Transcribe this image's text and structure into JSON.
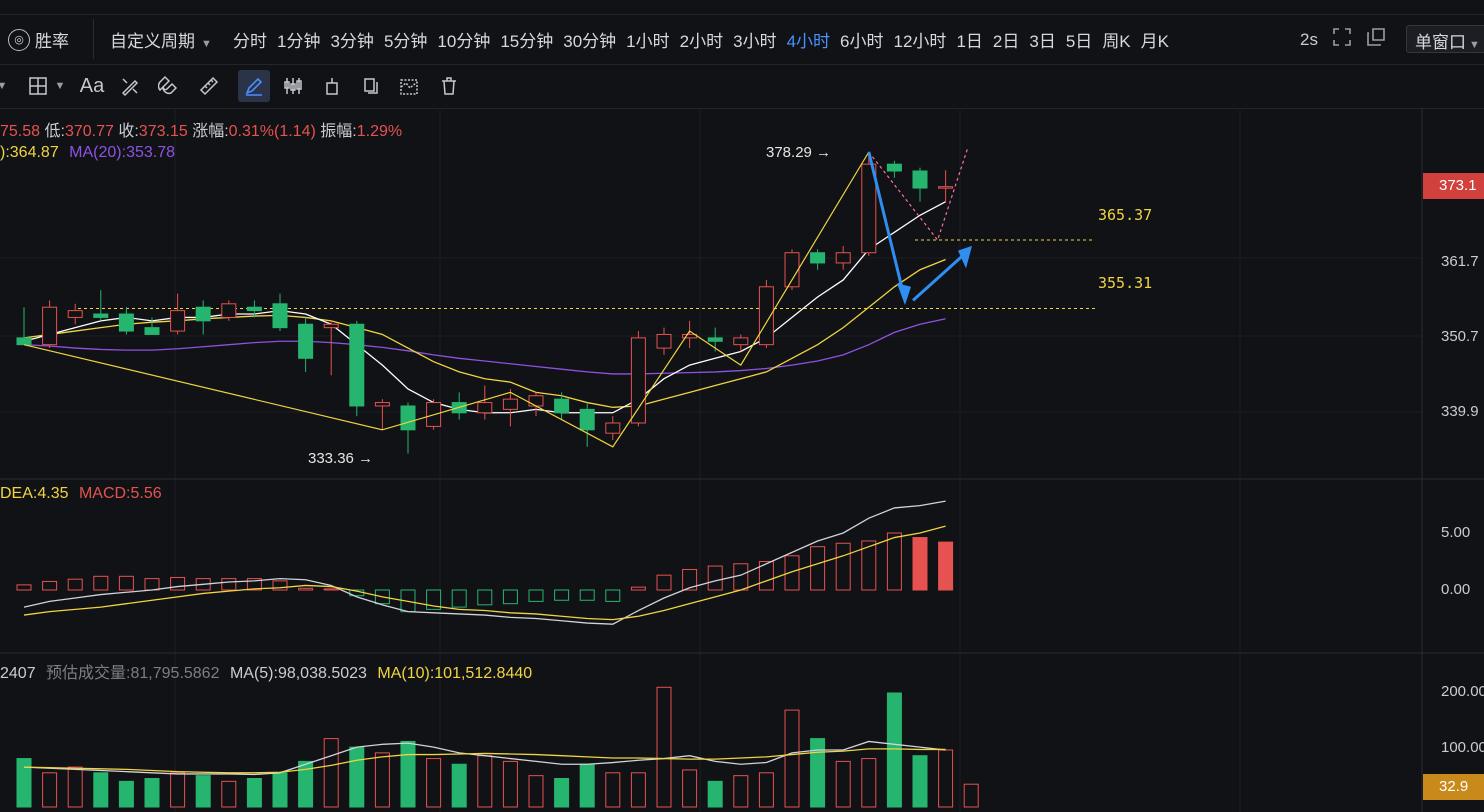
{
  "topbar": {
    "winrate_label": "胜率",
    "custom_period_label": "自定义周期",
    "periods": [
      "分时",
      "1分钟",
      "3分钟",
      "5分钟",
      "10分钟",
      "15分钟",
      "30分钟",
      "1小时",
      "2小时",
      "3小时",
      "4小时",
      "6小时",
      "12小时",
      "1日",
      "2日",
      "3日",
      "5日",
      "周K",
      "月K"
    ],
    "active_period": "4小时",
    "refresh_label": "2s",
    "window_select": "单窗口"
  },
  "toolbar": {
    "text_tool_label": "Aa",
    "icons": [
      "chevron-down-icon",
      "crosshair-grid-icon",
      "text-icon",
      "brush-eraser-icon",
      "magnet-icon",
      "ruler-icon",
      "pen-icon",
      "candles-icon",
      "anchor-icon",
      "copy-icon",
      "measure-icon",
      "trash-icon"
    ]
  },
  "info": {
    "high_partial": "75.58",
    "low_label": "低:",
    "low_value": "370.77",
    "close_label": "收:",
    "close_value": "373.15",
    "change_label": "涨幅:",
    "change_value": "0.31%(1.14)",
    "amp_label": "振幅:",
    "amp_value": "1.29%",
    "ma_partial": "):364.87",
    "ma20_label": "MA(20):353.78",
    "macd_dea": "DEA:4.35",
    "macd_val": "MACD:5.56",
    "vol_partial": "2407",
    "vol_est_label": "预估成交量:",
    "vol_est_value": "81,795.5862",
    "vol_ma5": "MA(5):98,038.5023",
    "vol_ma10": "MA(10):101,512.8440"
  },
  "chart_data": {
    "type": "candlestick",
    "price_axis": [
      "361.7",
      "350.7",
      "339.9"
    ],
    "current_price": "373.1",
    "high_marker": "378.29",
    "low_marker": "333.36",
    "levels": [
      {
        "value": "365.37",
        "price": 365.37
      },
      {
        "value": "355.31",
        "price": 355.31
      }
    ],
    "price_range": [
      330,
      382
    ],
    "candles": [
      {
        "o": 351.0,
        "h": 355.5,
        "l": 350.0,
        "c": 350.0
      },
      {
        "o": 350.0,
        "h": 356.5,
        "l": 349.5,
        "c": 355.5
      },
      {
        "o": 354.0,
        "h": 356.0,
        "l": 353.0,
        "c": 355.0
      },
      {
        "o": 354.5,
        "h": 358.0,
        "l": 353.5,
        "c": 354.0
      },
      {
        "o": 354.5,
        "h": 355.5,
        "l": 351.5,
        "c": 352.0
      },
      {
        "o": 352.5,
        "h": 354.0,
        "l": 351.5,
        "c": 351.5
      },
      {
        "o": 352.0,
        "h": 357.5,
        "l": 351.5,
        "c": 355.0
      },
      {
        "o": 355.5,
        "h": 356.5,
        "l": 351.5,
        "c": 353.5
      },
      {
        "o": 354.0,
        "h": 356.5,
        "l": 353.5,
        "c": 356.0
      },
      {
        "o": 355.5,
        "h": 356.5,
        "l": 354.0,
        "c": 355.0
      },
      {
        "o": 356.0,
        "h": 357.5,
        "l": 352.0,
        "c": 352.5
      },
      {
        "o": 353.0,
        "h": 354.0,
        "l": 346.0,
        "c": 348.0
      },
      {
        "o": 352.5,
        "h": 353.5,
        "l": 345.5,
        "c": 353.0
      },
      {
        "o": 353.0,
        "h": 353.5,
        "l": 339.5,
        "c": 341.0
      },
      {
        "o": 341.0,
        "h": 342.0,
        "l": 337.5,
        "c": 341.5
      },
      {
        "o": 341.0,
        "h": 341.5,
        "l": 334.0,
        "c": 337.5
      },
      {
        "o": 338.0,
        "h": 342.0,
        "l": 337.5,
        "c": 341.5
      },
      {
        "o": 341.5,
        "h": 343.0,
        "l": 339.0,
        "c": 340.0
      },
      {
        "o": 340.0,
        "h": 344.0,
        "l": 339.0,
        "c": 341.5
      },
      {
        "o": 340.5,
        "h": 343.5,
        "l": 338.0,
        "c": 342.0
      },
      {
        "o": 341.0,
        "h": 343.0,
        "l": 339.5,
        "c": 342.5
      },
      {
        "o": 342.0,
        "h": 343.0,
        "l": 339.0,
        "c": 340.0
      },
      {
        "o": 340.5,
        "h": 341.5,
        "l": 335.0,
        "c": 337.5
      },
      {
        "o": 337.0,
        "h": 339.5,
        "l": 336.0,
        "c": 338.5
      },
      {
        "o": 338.5,
        "h": 352.0,
        "l": 338.0,
        "c": 351.0
      },
      {
        "o": 349.5,
        "h": 352.5,
        "l": 348.5,
        "c": 351.5
      },
      {
        "o": 351.0,
        "h": 353.5,
        "l": 349.5,
        "c": 351.5
      },
      {
        "o": 351.0,
        "h": 352.5,
        "l": 349.0,
        "c": 350.5
      },
      {
        "o": 350.0,
        "h": 351.5,
        "l": 349.0,
        "c": 351.0
      },
      {
        "o": 350.0,
        "h": 359.5,
        "l": 349.5,
        "c": 358.5
      },
      {
        "o": 358.5,
        "h": 364.0,
        "l": 358.0,
        "c": 363.5
      },
      {
        "o": 363.5,
        "h": 364.0,
        "l": 361.0,
        "c": 362.0
      },
      {
        "o": 362.0,
        "h": 364.5,
        "l": 361.0,
        "c": 363.5
      },
      {
        "o": 363.5,
        "h": 378.3,
        "l": 363.0,
        "c": 376.5
      },
      {
        "o": 376.5,
        "h": 377.0,
        "l": 374.5,
        "c": 375.5
      },
      {
        "o": 375.5,
        "h": 376.0,
        "l": 371.0,
        "c": 373.0
      },
      {
        "o": 373.0,
        "h": 375.6,
        "l": 370.8,
        "c": 373.2
      }
    ],
    "ma5": [
      350.5,
      351.5,
      352.5,
      353.5,
      354,
      353.5,
      354,
      354,
      354.5,
      354.5,
      355,
      354.5,
      353,
      350,
      347,
      343.5,
      341.5,
      340.5,
      340,
      340,
      340.5,
      340,
      340,
      340,
      342,
      345,
      347,
      348,
      349,
      351,
      354,
      357,
      359.5,
      364,
      366.5,
      369,
      371
    ],
    "ma10": [
      351,
      351.5,
      352,
      352.5,
      353,
      353.3,
      353.5,
      353.8,
      354,
      354.2,
      354.3,
      354,
      353.5,
      352.5,
      351.5,
      349.5,
      347.5,
      346,
      345,
      344.5,
      343,
      342.5,
      341.5,
      340.8,
      341,
      342,
      343,
      344,
      345,
      346,
      348,
      350,
      352.5,
      355.5,
      358.5,
      361,
      362.5
    ],
    "ma20": [
      350,
      349.8,
      349.5,
      349.3,
      349.2,
      349.2,
      349.4,
      349.7,
      350,
      350.3,
      350.5,
      350.5,
      350.3,
      350.0,
      349.6,
      349.1,
      348.5,
      348,
      347.6,
      347.2,
      346.8,
      346.4,
      346,
      345.7,
      345.7,
      345.8,
      345.9,
      346,
      346.2,
      346.5,
      347,
      347.6,
      348.5,
      350,
      351.8,
      353,
      353.8
    ],
    "macd_hist": [
      0.45,
      0.75,
      0.95,
      1.2,
      1.2,
      1.0,
      1.1,
      1.0,
      1.0,
      1.0,
      0.8,
      0.15,
      0.1,
      -0.5,
      -1.2,
      -1.9,
      -1.7,
      -1.5,
      -1.3,
      -1.2,
      -1.0,
      -0.9,
      -0.9,
      -1.0,
      0.25,
      1.3,
      1.8,
      2.1,
      2.3,
      2.5,
      3.0,
      3.8,
      4.1,
      4.3,
      5.0,
      4.6,
      4.2
    ],
    "macd_line": [
      -1.5,
      -1.0,
      -0.7,
      -0.4,
      -0.2,
      0,
      0.3,
      0.5,
      0.7,
      0.8,
      1.0,
      0.9,
      0.4,
      -0.6,
      -1.3,
      -1.9,
      -2.0,
      -2.1,
      -2.2,
      -2.4,
      -2.5,
      -2.7,
      -2.9,
      -3.0,
      -1.8,
      -0.7,
      0.2,
      0.8,
      1.3,
      2.3,
      3.3,
      4.3,
      5.0,
      6.3,
      7.2,
      7.4,
      7.8
    ],
    "dea_line": [
      -2.2,
      -1.9,
      -1.7,
      -1.5,
      -1.2,
      -0.9,
      -0.6,
      -0.3,
      -0.1,
      0.1,
      0.2,
      0.4,
      0.3,
      -0.1,
      -0.6,
      -1.0,
      -1.4,
      -1.7,
      -1.8,
      -2.0,
      -2.1,
      -2.3,
      -2.5,
      -2.6,
      -2.3,
      -1.8,
      -1.2,
      -0.6,
      0,
      0.8,
      1.6,
      2.3,
      3.0,
      3.8,
      4.6,
      5.0,
      5.6
    ],
    "macd_axis": [
      "5.00",
      "0.00"
    ],
    "volume": [
      85,
      60,
      70,
      60,
      45,
      50,
      60,
      55,
      45,
      50,
      60,
      80,
      120,
      105,
      95,
      115,
      85,
      75,
      90,
      80,
      55,
      50,
      75,
      60,
      60,
      210,
      65,
      45,
      55,
      60,
      170,
      120,
      80,
      85,
      200,
      90,
      100,
      40
    ],
    "volume_ma5": [
      70,
      68,
      66,
      64,
      62,
      60,
      58,
      58,
      58,
      57,
      60,
      75,
      90,
      105,
      110,
      112,
      105,
      95,
      90,
      85,
      80,
      75,
      75,
      78,
      82,
      85,
      90,
      80,
      75,
      78,
      95,
      100,
      100,
      115,
      110,
      105,
      100
    ],
    "volume_ma10": [
      70,
      69,
      68,
      67,
      66,
      64,
      62,
      61,
      60,
      60,
      61,
      66,
      73,
      82,
      88,
      92,
      92,
      93,
      94,
      93,
      92,
      90,
      88,
      86,
      86,
      85,
      84,
      84,
      86,
      88,
      92,
      96,
      98,
      102,
      102,
      101,
      101
    ],
    "volume_axis": [
      "200.00",
      "100.00"
    ],
    "current_volume": "32.9"
  },
  "colors": {
    "up": "#e6524f",
    "down": "#26b56e",
    "ma5": "#ffffff",
    "ma10": "#f0d440",
    "ma20": "#8e52e0",
    "active": "#4a90ff",
    "arrow": "#2f8ff0"
  }
}
